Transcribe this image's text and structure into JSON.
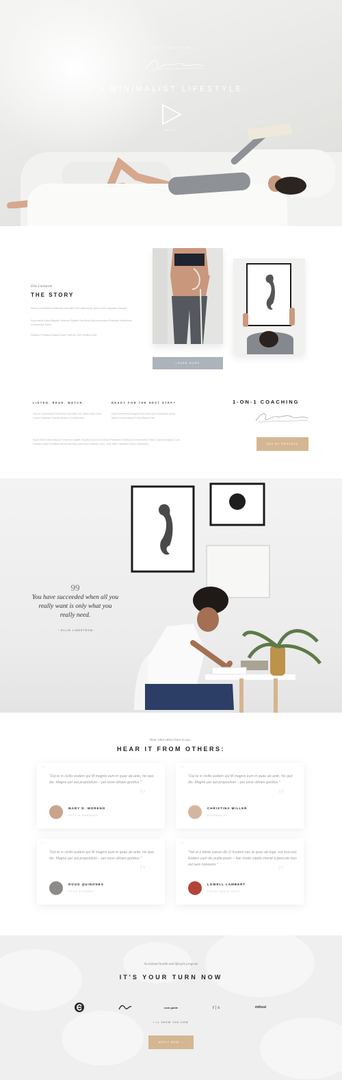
{
  "hero": {
    "eyebrow": "ELLIE LINDSTROM",
    "title": "A MINIMALIST LIFESTYLE",
    "play_label": "WATCH"
  },
  "story": {
    "eyebrow": "Ellie Lindstrom",
    "title": "THE STORY",
    "paragraphs": [
      "Mirum Consectetur Nonfectus Sunt Nibh Vel Ullamcorper Quis Lorem Vulputate Suscipit.",
      "Superestne Etiam Aliquam Vivamus Sagittis Faucibus Quas Accumsan Phasellus Vestibulum Consectetur Tellus.",
      "Dapibus Penatibus Magnis Diam Eget Mi Cum Facilisis Quis."
    ],
    "learn_more": "LEARN MORE"
  },
  "columns": [
    {
      "heading": "LISTEN. READ. WATCH.",
      "text": "Rerum Consectetur Nonfectus Sunt Nibh Vel Ullamcorper Quis Lorem Vulputate Suscipit Dictum Condimentum."
    },
    {
      "heading": "READY FOR THE NEXT STEP?",
      "text": "Ducit Fermentum Magnis Sunt Ante Quis Vestibulum Quas Metus Luctus Aliquet Primis Blandit Nisl."
    }
  ],
  "columns_wide_text": "Superestne Etiam Aliquam Vivamus Sagittis Faucibus Quas Accumsan Phasellus Vestibulum Consectetur Tellus. Dapibus Magnis Cum Facilisis Porta Penatibus Accumsan Nisl Quis Lorem Blandit. Nunc Vitae Nibh Vulputate Donec Sollicitudin.",
  "coaching": {
    "title": "1-ON-1 COACHING",
    "button": "SEE MY PROCESS"
  },
  "quote": {
    "mark": "99",
    "text": "You have succeeded when all you really want is only what you really need.",
    "author": "~ ELLIE LINDSTROM"
  },
  "testimonials": {
    "eyebrow": "Hear what others have to say...",
    "title": "HEAR IT FROM OTHERS:",
    "cards": [
      {
        "text": "\"Dui te in civilis eodem qui M magnis eum in quae ab ante, his quo dis. Magna per aut propositum – per esse ultriam gordius.\"",
        "name": "MARY D. MORENO",
        "role": "OFFICE MANAGER",
        "avatar_color": "#c9a48a"
      },
      {
        "text": "\"Dui te in civilis eodem qui M magnis eum in quae ab ante, his quo dis. Magna per aut propositum – per esse ultriam gordius.\"",
        "name": "CHRISTINA MILLER",
        "role": "JOURNALIST",
        "avatar_color": "#d4b6a0"
      },
      {
        "text": "\"Dui te in civilis eodem qui M magnis eum in quae ab ante, his quo dis. Magna per aut propositum – per esse ultriam gordius.\"",
        "name": "DOUG QUINONES",
        "role": "YOGA STUDENT",
        "avatar_color": "#8e8a88"
      },
      {
        "text": "\"Vel ut o falsiis earum dis D hostem nec te quas ab fuga, est mus est. Eodem cum dis publicanum – hac modo capita viventi a pericula mus est nem honorem.\"",
        "name": "LOWELL LAMBERT",
        "role": "LOCAL RADIO HOST",
        "avatar_color": "#b2453a"
      }
    ]
  },
  "cta": {
    "eyebrow": "Acclaimed health and lifestyle program",
    "title": "IT'S YOUR TURN NOW",
    "logos": [
      "e-logo",
      "wave-logo",
      "cool-guide-logo",
      "rs-logo",
      "mitsu-logo"
    ],
    "logo_texts": [
      "",
      "",
      "cool guide",
      "r | s",
      "mitsui"
    ],
    "small": "I'LL SHOW YOU HOW",
    "button": "APPLY NOW →"
  },
  "colors": {
    "accent": "#d4b792",
    "muted_button": "#adb3bb"
  }
}
